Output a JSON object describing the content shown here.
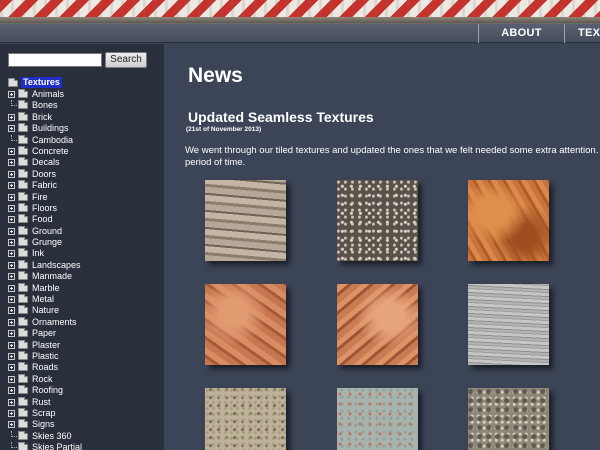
{
  "nav": {
    "items": [
      "ABOUT",
      "TEXT"
    ]
  },
  "search": {
    "value": "",
    "button_label": "Search"
  },
  "tree": {
    "root": "Textures",
    "items": [
      {
        "label": "Animals",
        "expandable": true
      },
      {
        "label": "Bones",
        "expandable": false
      },
      {
        "label": "Brick",
        "expandable": true
      },
      {
        "label": "Buildings",
        "expandable": true
      },
      {
        "label": "Cambodia",
        "expandable": false
      },
      {
        "label": "Concrete",
        "expandable": true
      },
      {
        "label": "Decals",
        "expandable": true
      },
      {
        "label": "Doors",
        "expandable": true
      },
      {
        "label": "Fabric",
        "expandable": true
      },
      {
        "label": "Fire",
        "expandable": true
      },
      {
        "label": "Floors",
        "expandable": true
      },
      {
        "label": "Food",
        "expandable": true
      },
      {
        "label": "Ground",
        "expandable": true
      },
      {
        "label": "Grunge",
        "expandable": true
      },
      {
        "label": "Ink",
        "expandable": true
      },
      {
        "label": "Landscapes",
        "expandable": true
      },
      {
        "label": "Manmade",
        "expandable": true
      },
      {
        "label": "Marble",
        "expandable": true
      },
      {
        "label": "Metal",
        "expandable": true
      },
      {
        "label": "Nature",
        "expandable": true
      },
      {
        "label": "Ornaments",
        "expandable": true
      },
      {
        "label": "Paper",
        "expandable": true
      },
      {
        "label": "Plaster",
        "expandable": true
      },
      {
        "label": "Plastic",
        "expandable": true
      },
      {
        "label": "Roads",
        "expandable": true
      },
      {
        "label": "Rock",
        "expandable": true
      },
      {
        "label": "Roofing",
        "expandable": true
      },
      {
        "label": "Rust",
        "expandable": true
      },
      {
        "label": "Scrap",
        "expandable": true
      },
      {
        "label": "Signs",
        "expandable": true
      },
      {
        "label": "Skies 360",
        "expandable": false
      },
      {
        "label": "Skies Partial",
        "expandable": false
      }
    ]
  },
  "main": {
    "title": "News",
    "post": {
      "title": "Updated Seamless Textures",
      "date": "(21st of November 2013)",
      "body": "We went through our tiled textures and updated the ones that we felt needed some extra attention. over a period of time."
    }
  },
  "colors": {
    "background": "#3c4457",
    "sidebar": "#2a2f3c",
    "tree_selected": "#1e2ec9",
    "banner_red": "#c8302c"
  }
}
